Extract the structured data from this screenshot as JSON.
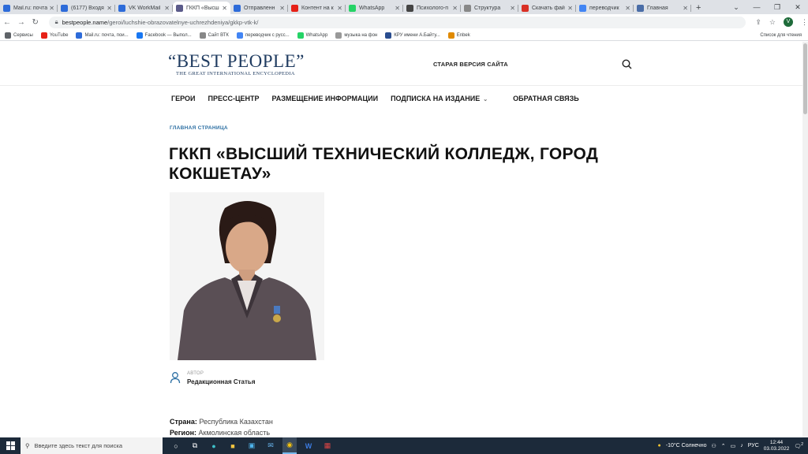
{
  "browser": {
    "tabs": [
      {
        "title": "Mail.ru: почта",
        "color": "#2d6bd9"
      },
      {
        "title": "(6177) Входя",
        "color": "#2d6bd9"
      },
      {
        "title": "VK WorkMail",
        "color": "#2d6bd9"
      },
      {
        "title": "ГККП «Высш",
        "color": "#5b5b8a",
        "active": true
      },
      {
        "title": "Отправленн",
        "color": "#2d6bd9"
      },
      {
        "title": "Контент на к",
        "color": "#e62117"
      },
      {
        "title": "WhatsApp",
        "color": "#25d366"
      },
      {
        "title": "Психолого-п",
        "color": "#444"
      },
      {
        "title": "Структура",
        "color": "#888"
      },
      {
        "title": "Скачать фай",
        "color": "#d93025"
      },
      {
        "title": "переводчик",
        "color": "#4285f4"
      },
      {
        "title": "Главная",
        "color": "#4a6da7"
      }
    ],
    "address": {
      "host": "bestpeople.name",
      "path": "/geroi/luchshie-obrazovatelnye-uchrezhdeniya/gkkp-vtk-k/"
    },
    "profile_initial": "V",
    "bookmarks": [
      {
        "label": "Сервисы",
        "color": "#5f6368"
      },
      {
        "label": "YouTube",
        "color": "#e62117"
      },
      {
        "label": "Mail.ru: почта, пои...",
        "color": "#2d6bd9"
      },
      {
        "label": "Facebook — Выпол...",
        "color": "#1877f2"
      },
      {
        "label": "Сайт ВТК",
        "color": "#888"
      },
      {
        "label": "переводчик с русс...",
        "color": "#4285f4"
      },
      {
        "label": "WhatsApp",
        "color": "#25d366"
      },
      {
        "label": "музыка на фон",
        "color": "#999"
      },
      {
        "label": "КРУ имени А.Байту...",
        "color": "#2a4d8f"
      },
      {
        "label": "Enbek",
        "color": "#e08a00"
      }
    ],
    "reading_list": "Список для чтения"
  },
  "site": {
    "logo_main": "“BEST PEOPLE”",
    "logo_sub": "THE GREAT INTERNATIONAL ENCYCLOPEDIA",
    "old_version": "СТАРАЯ ВЕРСИЯ САЙТА",
    "nav": [
      "ГЕРОИ",
      "ПРЕСС-ЦЕНТР",
      "РАЗМЕЩЕНИЕ ИНФОРМАЦИИ",
      "ПОДПИСКА НА ИЗДАНИЕ",
      "ОБРАТНАЯ СВЯЗЬ"
    ],
    "breadcrumb": "ГЛАВНАЯ СТРАНИЦА",
    "title": "ГККП «ВЫСШИЙ ТЕХНИЧЕСКИЙ КОЛЛЕДЖ, ГОРОД КОКШЕТАУ»",
    "author_label": "АВТОР",
    "author_name": "Редакционная Статья",
    "country_label": "Страна:",
    "country_value": "Республика Казахстан",
    "region_label": "Регион:",
    "region_value": "Акмолинская область"
  },
  "taskbar": {
    "search_placeholder": "Введите здесь текст для поиска",
    "weather": "-10°C  Солнечно",
    "lang": "РУС",
    "time": "12:44",
    "date": "03.03.2022",
    "notifications": "2"
  }
}
